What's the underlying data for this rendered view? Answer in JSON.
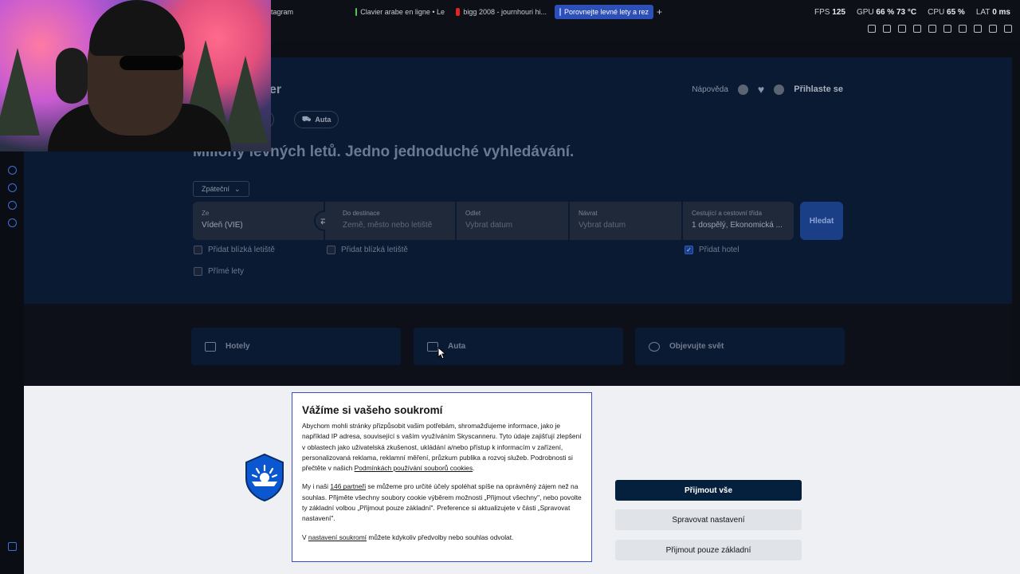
{
  "browser": {
    "tabs": [
      {
        "label": "tagram"
      },
      {
        "label": "Clavier arabe en ligne • Le"
      },
      {
        "label": "bigg 2008 - journhouri hi..."
      },
      {
        "label": "Porovnejte levné lety a rez",
        "active": true
      }
    ],
    "new_tab": "+",
    "stats": {
      "fps_label": "FPS",
      "fps": "125",
      "gpu_label": "GPU",
      "gpu": "66 % 73 °C",
      "cpu_label": "CPU",
      "cpu": "65 %",
      "lat_label": "LAT",
      "lat": "0 ms"
    }
  },
  "header": {
    "logo": "er",
    "help": "Nápověda",
    "login": "Přihlaste se"
  },
  "category_pills": [
    {
      "label": "tely"
    },
    {
      "label": "Auta"
    }
  ],
  "hero": {
    "headline": "Milióny levných letů. Jedno jednoduché vyhledávání.",
    "trip_type": "Zpáteční"
  },
  "search": {
    "from": {
      "label": "Ze",
      "value": "Vídeň (VIE)"
    },
    "to": {
      "label": "Do destinace",
      "placeholder": "Země, město nebo letiště"
    },
    "depart": {
      "label": "Odlet",
      "placeholder": "Vybrat datum"
    },
    "return": {
      "label": "Návrat",
      "placeholder": "Vybrat datum"
    },
    "travellers": {
      "label": "Cestující a cestovní třída",
      "value": "1 dospělý, Ekonomická ..."
    },
    "search_button": "Hledat",
    "nearby_from": "Přidat blízká letiště",
    "nearby_to": "Přidat blízká letiště",
    "add_hotel": "Přidat hotel",
    "direct": "Přímé lety"
  },
  "cards": [
    {
      "label": "Hotely",
      "icon": "bed-icon"
    },
    {
      "label": "Auta",
      "icon": "car-icon"
    },
    {
      "label": "Objevujte svět",
      "icon": "globe-icon"
    }
  ],
  "cookie": {
    "title": "Vážíme si vašeho soukromí",
    "p1": "Abychom mohli stránky přizpůsobit vašim potřebám, shromažďujeme informace, jako je například IP adresa, související s vaším využíváním Skyscanneru. Tyto údaje zajišťují zlepšení v oblastech jako uživatelská zkušenost, ukládání a/nebo přístup k informacím v zařízení, personalizovaná reklama, reklamní měření, průzkum publika a rozvoj služeb. Podrobnosti si přečtěte v našich ",
    "p1_link": "Podmínkách používání souborů cookies",
    "p1_end": ".",
    "p2_start": "My i naši ",
    "p2_link": "146 partneři",
    "p2_rest": " se můžeme pro určité účely spoléhat spíše na oprávněný zájem než na souhlas. Přijměte všechny soubory cookie výběrem možnosti „Přijmout všechny\", nebo povolte ty základní volbou „Přijmout pouze základní\". Preference si aktualizujete v části „Spravovat nastavení\".",
    "p3_start": "V ",
    "p3_link": "nastavení soukromí",
    "p3_rest": " můžete kdykoliv předvolby nebo souhlas odvolat.",
    "accept_all": "Přijmout vše",
    "manage": "Spravovat nastavení",
    "accept_basic": "Přijmout pouze základní"
  },
  "colors": {
    "hero_bg": "#0a1a33",
    "primary_button": "#05203c",
    "accent": "#2c4fb8"
  }
}
